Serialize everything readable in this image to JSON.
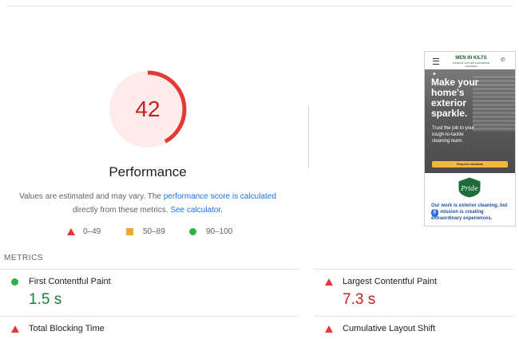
{
  "performance": {
    "score": 42,
    "score_fraction": 0.42,
    "title": "Performance",
    "description": {
      "prefix": "Values are estimated and may vary. The ",
      "link1": "performance score is calculated",
      "middle": " directly from these metrics. ",
      "link2": "See calculator",
      "suffix": "."
    },
    "colors": {
      "fail": "#e53935",
      "fail_bg": "#fdeceb",
      "average": "#f4a533",
      "pass": "#28b446"
    }
  },
  "legend": [
    {
      "icon": "triangle-fail-icon",
      "label": "0–49"
    },
    {
      "icon": "square-average-icon",
      "label": "50–89"
    },
    {
      "icon": "circle-pass-icon",
      "label": "90–100"
    }
  ],
  "screenshot": {
    "logo": "MEN IN KILTS",
    "logo_sub": "WINDOW, GUTTER & EXTERIOR CLEANING",
    "headline": "Make your home's exterior sparkle.",
    "subtext": "Trust the job to your tough-to-tackle cleaning team.",
    "button": "Request estimate",
    "badge": "Pride",
    "mission": "Our work is exterior cleaning, but our mission is creating extraordinary experiences."
  },
  "metrics": {
    "heading": "METRICS",
    "items": [
      {
        "name": "First Contentful Paint",
        "value": "1.5 s",
        "status": "pass"
      },
      {
        "name": "Largest Contentful Paint",
        "value": "7.3 s",
        "status": "fail"
      },
      {
        "name": "Total Blocking Time",
        "value": "",
        "status": "fail"
      },
      {
        "name": "Cumulative Layout Shift",
        "value": "",
        "status": "fail"
      }
    ]
  }
}
